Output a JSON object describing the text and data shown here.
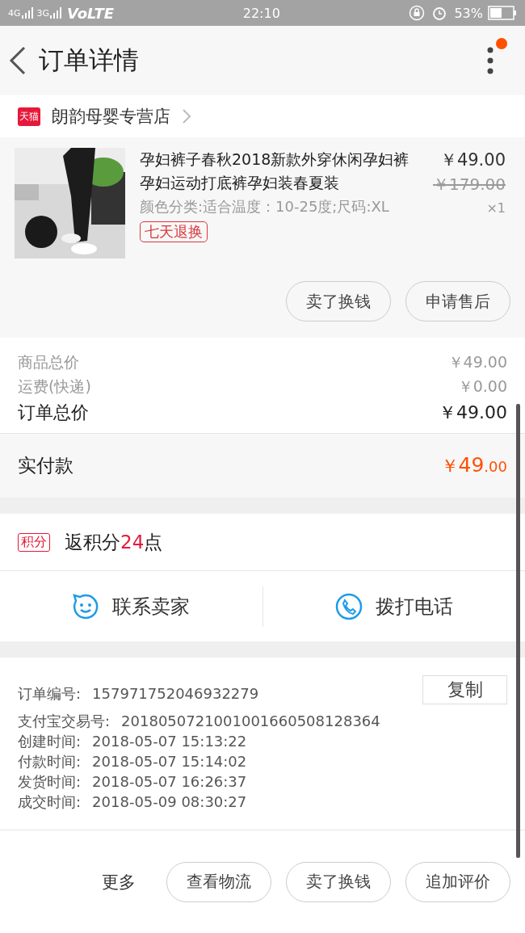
{
  "status_bar": {
    "network_1": "4G",
    "network_2": "3G",
    "volte": "VoLTE",
    "time": "22:10",
    "battery": "53%"
  },
  "header": {
    "title": "订单详情",
    "has_notification": true
  },
  "store": {
    "badge": "天猫",
    "name": "朗韵母婴专营店"
  },
  "product": {
    "title": "孕妇裤子春秋2018新款外穿休闲孕妇裤孕妇运动打底裤孕妇装春夏装",
    "sku": "颜色分类:适合温度：10-25度;尺码:XL",
    "tag": "七天退换",
    "price": "￥49.00",
    "original_price": "￥179.00",
    "quantity": "×1",
    "buttons": [
      "卖了换钱",
      "申请售后"
    ]
  },
  "costs": [
    {
      "label": "商品总价",
      "value": "￥49.00",
      "kind": "minor"
    },
    {
      "label": "运费(快递)",
      "value": "￥0.00",
      "kind": "minor"
    },
    {
      "label": "订单总价",
      "value": "￥49.00",
      "kind": "major"
    }
  ],
  "paid": {
    "label": "实付款",
    "currency": "￥",
    "amount": "49",
    "cents": ".00"
  },
  "points": {
    "badge": "积分",
    "prefix": "返积分",
    "count": "24",
    "suffix": "点"
  },
  "contacts": [
    {
      "label": "联系卖家",
      "kind": "chat"
    },
    {
      "label": "拨打电话",
      "kind": "phone"
    }
  ],
  "order_info": {
    "copy_button": "复制",
    "rows": [
      {
        "label": "订单编号:",
        "value": "157971752046932279"
      },
      {
        "label": "支付宝交易号:",
        "value": "2018050721001001660508128364"
      },
      {
        "label": "创建时间:",
        "value": "2018-05-07 15:13:22"
      },
      {
        "label": "付款时间:",
        "value": "2018-05-07 15:14:02"
      },
      {
        "label": "发货时间:",
        "value": "2018-05-07 16:26:37"
      },
      {
        "label": "成交时间:",
        "value": "2018-05-09 08:30:27"
      }
    ]
  },
  "bottom_bar": {
    "more": "更多",
    "buttons": [
      "查看物流",
      "卖了换钱",
      "追加评价"
    ]
  }
}
